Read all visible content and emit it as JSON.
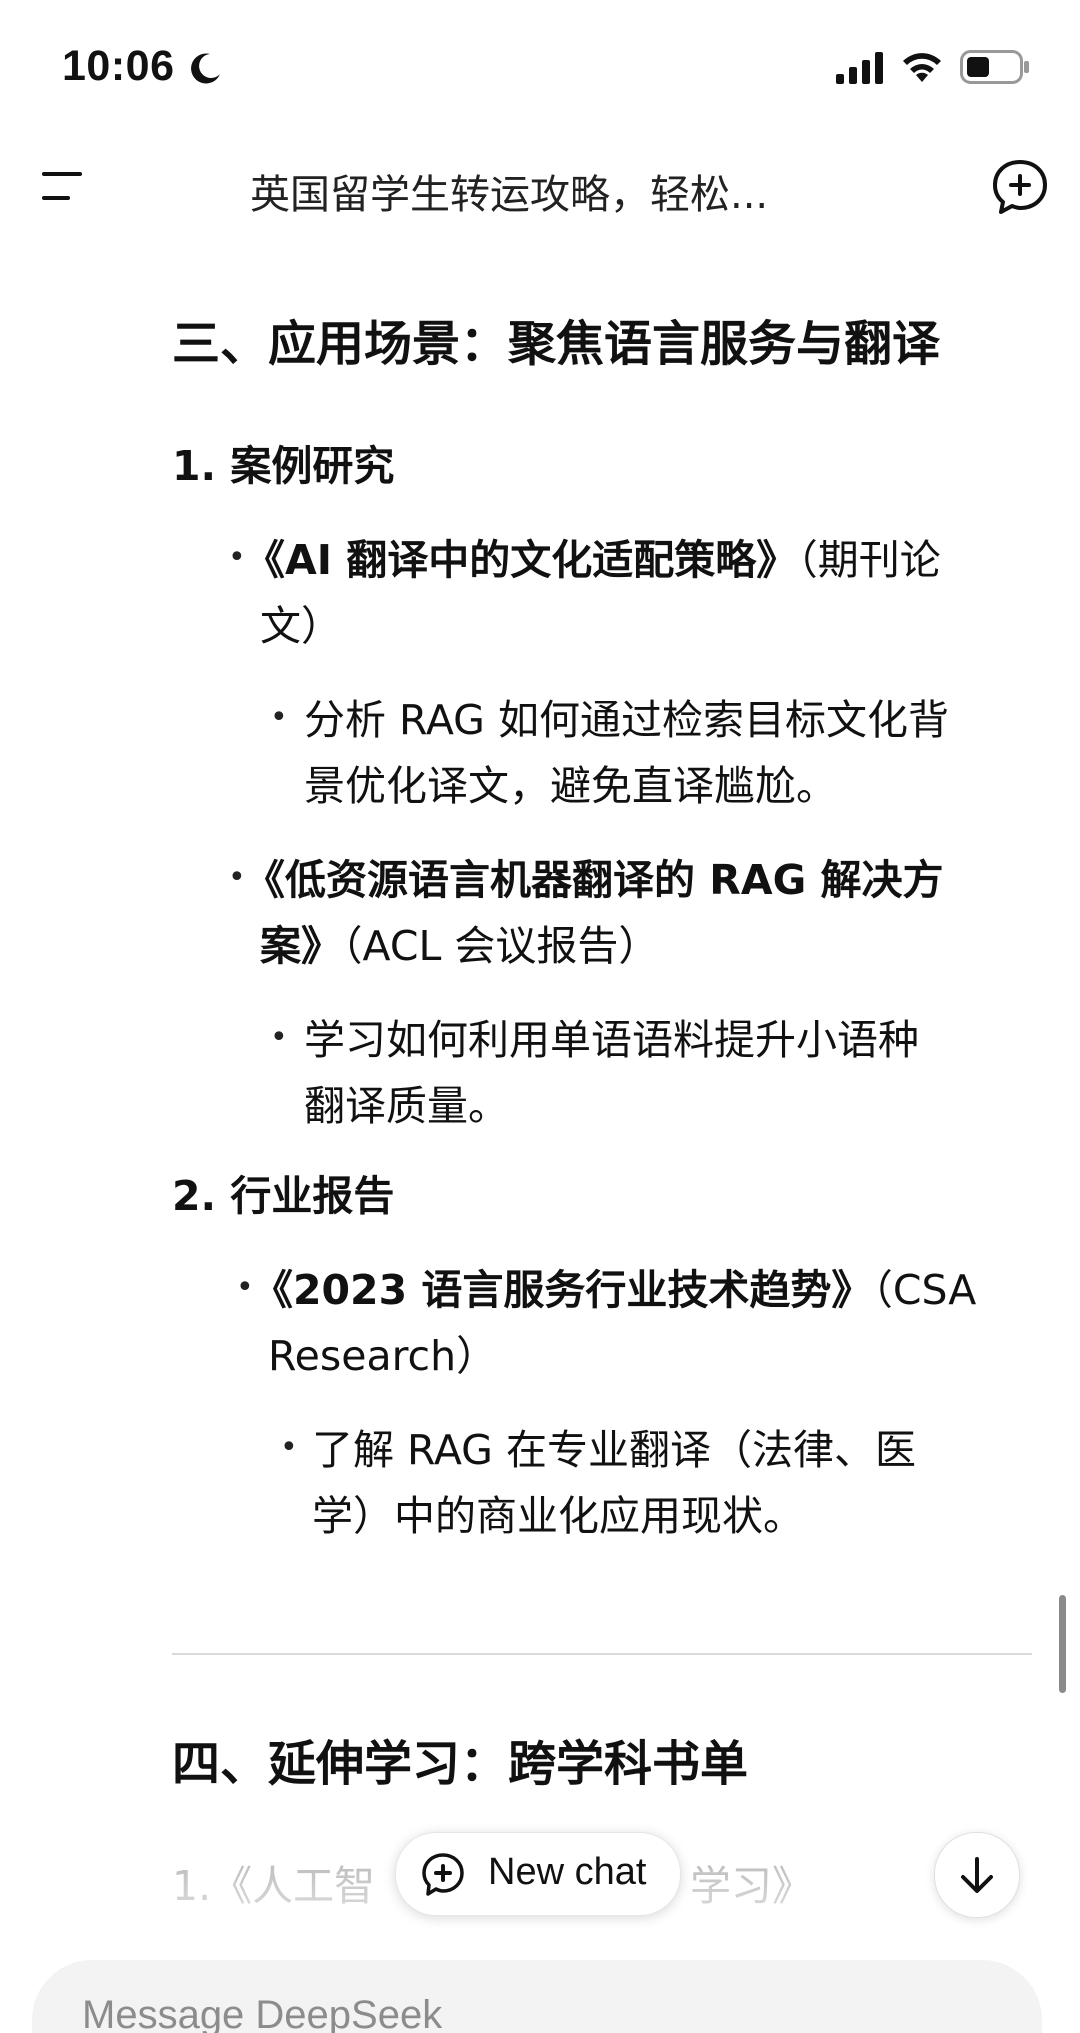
{
  "status_bar": {
    "time": "10:06",
    "icons": [
      "moon-icon",
      "signal-icon",
      "wifi-icon",
      "battery-icon"
    ]
  },
  "header": {
    "title": "英国留学生转运攻略，轻松...",
    "icons": [
      "menu-icon",
      "new-chat-icon"
    ]
  },
  "content": {
    "section3_title": "三、应用场景：聚焦语言服务与翻译",
    "item1_label": "1. 案例研究",
    "item1_sub1_title_line1": "《AI 翻译中的文化适配策略》",
    "item1_sub1_note_line1": "（期刊论",
    "item1_sub1_note_line2": "文）",
    "item1_sub1_detail_line1": "分析 RAG 如何通过检索目标文化背",
    "item1_sub1_detail_line2": "景优化译文，避免直译尴尬。",
    "item1_sub2_title_line1": "《低资源语言机器翻译的 RAG 解决方",
    "item1_sub2_title_line2": "案》",
    "item1_sub2_note": "（ACL 会议报告）",
    "item1_sub2_detail_line1": "学习如何利用单语语料提升小语种",
    "item1_sub2_detail_line2": "翻译质量。",
    "item2_label": "2. 行业报告",
    "item2_sub1_title": "《2023 语言服务行业技术趋势》",
    "item2_sub1_note_line1": "（CSA",
    "item2_sub1_note_line2": "Research）",
    "item2_sub1_detail_line1": "了解 RAG 在专业翻译（法律、医",
    "item2_sub1_detail_line2": "学）中的商业化应用现状。",
    "section4_title": "四、延伸学习：跨学科书单",
    "section4_item1_prefix": "1.《人工智",
    "section4_item1_suffix": "学习》"
  },
  "floating": {
    "new_chat_label": "New chat"
  },
  "composer": {
    "placeholder": "Message DeepSeek"
  },
  "colors": {
    "text": "#111111",
    "divider": "#d9d9d9",
    "input_bg": "#f3f3f3"
  }
}
